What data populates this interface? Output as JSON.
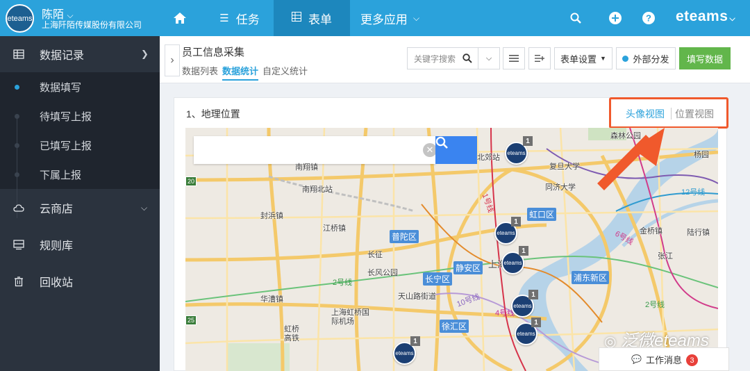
{
  "topbar": {
    "logo_text": "eteams",
    "user_name": "陈陌",
    "company": "上海阡陌传媒股份有限公司",
    "nav": {
      "tasks": "任务",
      "forms": "表单",
      "more": "更多应用"
    },
    "brand": "eteams",
    "colors": {
      "bar": "#2ba2db",
      "active": "#1d87bd"
    }
  },
  "sidebar": {
    "items": [
      {
        "label": "数据记录",
        "icon": "table-icon"
      },
      {
        "label": "云商店",
        "icon": "cloud-icon"
      },
      {
        "label": "规则库",
        "icon": "monitor-icon"
      },
      {
        "label": "回收站",
        "icon": "trash-icon"
      }
    ],
    "sub_items": [
      {
        "label": "数据填写",
        "active": true
      },
      {
        "label": "待填写上报",
        "active": false
      },
      {
        "label": "已填写上报",
        "active": false
      },
      {
        "label": "下属上报",
        "active": false
      }
    ]
  },
  "header": {
    "title": "员工信息采集",
    "tabs": [
      "数据列表",
      "数据统计",
      "自定义统计"
    ],
    "active_tab": "数据统计",
    "search_placeholder": "关键字搜索",
    "form_settings": "表单设置",
    "share": "外部分发",
    "fill_button": "填写数据"
  },
  "panel": {
    "title": "1、地理位置",
    "view_avatar": "头像视图",
    "view_location": "位置视图"
  },
  "map": {
    "labels": [
      "南翔镇",
      "南翔北站",
      "封浜镇",
      "江桥镇",
      "华漕镇",
      "长征",
      "长风公园",
      "天山路街道",
      "上海虹桥国际机场",
      "虹桥高铁",
      "北郊站",
      "复旦大学",
      "同济大学",
      "森林公园",
      "杨园",
      "金桥镇",
      "陆行镇",
      "上海",
      "张江"
    ],
    "districts": [
      "普陀区",
      "虹口区",
      "静安区",
      "长宁区",
      "浦东新区",
      "徐汇区"
    ],
    "metro": [
      "2号线",
      "10号线",
      "4号线",
      "12号线",
      "6号线",
      "2号线",
      "1号线"
    ],
    "road_numbers": [
      "25",
      "20"
    ],
    "pin_label": "eteams",
    "pin_counts": [
      "1",
      "1",
      "1",
      "1",
      "1",
      "1"
    ]
  },
  "watermark": "泛微eteams",
  "messages": {
    "label": "工作消息",
    "count": "3"
  }
}
